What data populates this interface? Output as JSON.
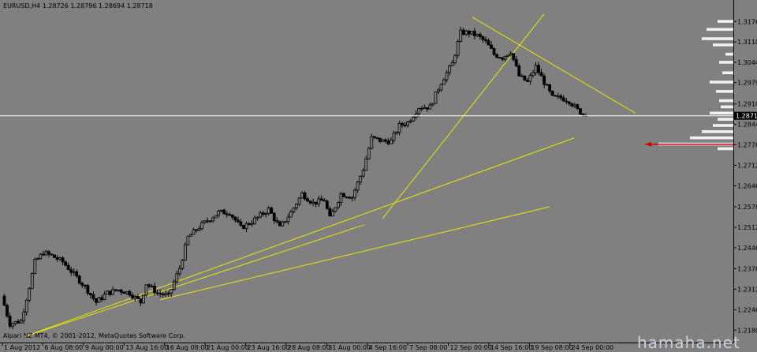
{
  "colors": {
    "background": "#808080",
    "candle": "#000000",
    "trendline": "#e8e800",
    "price_line": "#ffffff",
    "price_label_bg": "#000000",
    "profile": "#f0f0f0",
    "marker": "#cc0000",
    "watermark": "#c8d2dc"
  },
  "header": {
    "text": "EURUSD,H4  1.28726 1.28796 1.28694 1.28718"
  },
  "footer": {
    "copyright": "Alpari NZ MT4, © 2001-2012, MetaQuotes Software Corp."
  },
  "watermark": {
    "text": "hamaha.net"
  },
  "current_price_label": "1.2871",
  "chart_data": {
    "type": "candlestick",
    "symbol": "EURUSD",
    "timeframe": "H4",
    "last_bar": {
      "open": 1.28726,
      "high": 1.28796,
      "low": 1.28694,
      "close": 1.28718
    },
    "current_price": 1.28718,
    "ylim": [
      1.2145,
      1.322
    ],
    "y_ticks": [
      1.3176,
      1.311,
      1.3044,
      1.2979,
      1.291,
      1.2844,
      1.2778,
      1.2712,
      1.2646,
      1.2578,
      1.2512,
      1.2446,
      1.2378,
      1.2312,
      1.2246,
      1.218
    ],
    "x_ticks": [
      "1 Aug 2012",
      "6 Aug 08:00",
      "9 Aug 00:00",
      "13 Aug 16:00",
      "16 Aug 08:00",
      "21 Aug 00:00",
      "23 Aug 16:00",
      "28 Aug 08:00",
      "31 Aug 00:00",
      "4 Sep 16:00",
      "7 Sep 08:00",
      "12 Sep 00:00",
      "14 Sep 16:00",
      "19 Sep 08:00",
      "24 Sep 00:00"
    ],
    "bar_count": 210,
    "close_path": [
      [
        0,
        1.229
      ],
      [
        3,
        1.22
      ],
      [
        7,
        1.221
      ],
      [
        10,
        1.232
      ],
      [
        12,
        1.24
      ],
      [
        15,
        1.243
      ],
      [
        18,
        1.242
      ],
      [
        22,
        1.24
      ],
      [
        26,
        1.236
      ],
      [
        30,
        1.232
      ],
      [
        34,
        1.227
      ],
      [
        38,
        1.23
      ],
      [
        42,
        1.231
      ],
      [
        46,
        1.23
      ],
      [
        50,
        1.227
      ],
      [
        52,
        1.233
      ],
      [
        56,
        1.23
      ],
      [
        60,
        1.229
      ],
      [
        64,
        1.238
      ],
      [
        67,
        1.248
      ],
      [
        72,
        1.252
      ],
      [
        78,
        1.256
      ],
      [
        82,
        1.256
      ],
      [
        86,
        1.251
      ],
      [
        90,
        1.253
      ],
      [
        96,
        1.257
      ],
      [
        100,
        1.251
      ],
      [
        104,
        1.256
      ],
      [
        108,
        1.262
      ],
      [
        112,
        1.259
      ],
      [
        116,
        1.26
      ],
      [
        118,
        1.254
      ],
      [
        122,
        1.262
      ],
      [
        126,
        1.261
      ],
      [
        130,
        1.27
      ],
      [
        133,
        1.28
      ],
      [
        137,
        1.279
      ],
      [
        140,
        1.279
      ],
      [
        143,
        1.284
      ],
      [
        146,
        1.285
      ],
      [
        150,
        1.29
      ],
      [
        154,
        1.29
      ],
      [
        158,
        1.298
      ],
      [
        162,
        1.304
      ],
      [
        165,
        1.314
      ],
      [
        168,
        1.314
      ],
      [
        171,
        1.313
      ],
      [
        174,
        1.311
      ],
      [
        177,
        1.307
      ],
      [
        180,
        1.306
      ],
      [
        183,
        1.308
      ],
      [
        186,
        1.3
      ],
      [
        189,
        1.298
      ],
      [
        192,
        1.303
      ],
      [
        195,
        1.298
      ],
      [
        198,
        1.293
      ],
      [
        201,
        1.293
      ],
      [
        204,
        1.292
      ],
      [
        207,
        1.289
      ],
      [
        210,
        1.2872
      ]
    ],
    "trendlines": [
      {
        "from": [
          "1 Aug 2012",
          1.2158
        ],
        "to": [
          "25 Sep",
          1.28
        ]
      },
      {
        "from": [
          "16 Aug",
          1.2278
        ],
        "to": [
          "25 Sep",
          1.2578
        ]
      },
      {
        "from": [
          "4 Sep",
          1.254
        ],
        "to": [
          "18 Sep",
          1.32
        ]
      },
      {
        "from": [
          "14 Sep",
          1.319
        ],
        "to": [
          "26 Sep",
          1.288
        ]
      }
    ],
    "grid": false,
    "legend": "none"
  }
}
